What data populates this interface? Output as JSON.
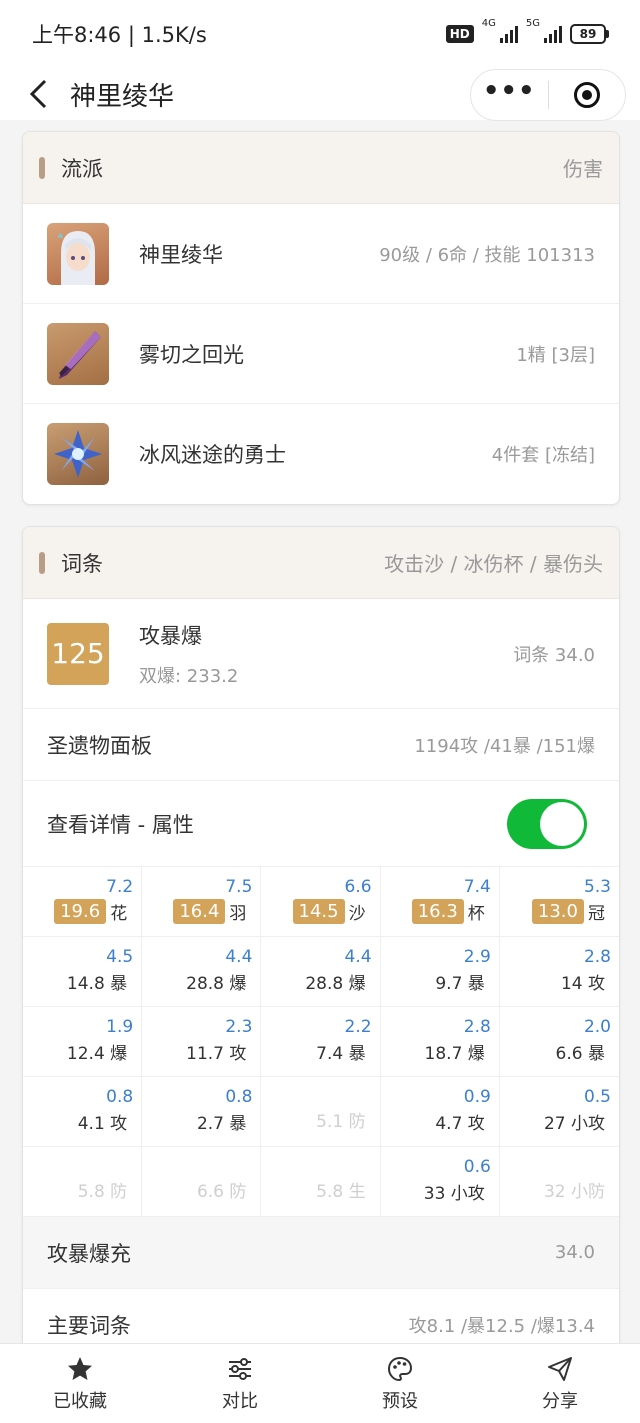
{
  "status_bar": {
    "time": "上午8:46 | 1.5K/s",
    "hd": "HD",
    "net1": "4G",
    "net2": "5G",
    "battery": "89"
  },
  "nav": {
    "title": "神里绫华"
  },
  "style_card": {
    "title": "流派",
    "right": "伤害",
    "items": [
      {
        "name": "神里绫华",
        "meta": "90级 / 6命 / 技能 101313"
      },
      {
        "name": "雾切之回光",
        "meta": "1精 [3层]"
      },
      {
        "name": "冰风迷途的勇士",
        "meta": "4件套 [冻结]"
      }
    ]
  },
  "stats_card": {
    "title": "词条",
    "right": "攻击沙 / 冰伤杯 / 暴伤头",
    "score": "125",
    "score_title": "攻暴爆",
    "score_sub": "双爆: 233.2",
    "score_right": "词条 34.0",
    "panel_label": "圣遗物面板",
    "panel_value": "1194攻 /41暴 /151爆",
    "detail_label": "查看详情 - 属性",
    "grid": [
      [
        {
          "top": "7.2",
          "pill": "19.6",
          "main": "花"
        },
        {
          "top": "7.5",
          "pill": "16.4",
          "main": "羽"
        },
        {
          "top": "6.6",
          "pill": "14.5",
          "main": "沙"
        },
        {
          "top": "7.4",
          "pill": "16.3",
          "main": "杯"
        },
        {
          "top": "5.3",
          "pill": "13.0",
          "main": "冠"
        }
      ],
      [
        {
          "top": "4.5",
          "main": "14.8 暴"
        },
        {
          "top": "4.4",
          "main": "28.8 爆"
        },
        {
          "top": "4.4",
          "main": "28.8 爆"
        },
        {
          "top": "2.9",
          "main": "9.7 暴"
        },
        {
          "top": "2.8",
          "main": "14 攻"
        }
      ],
      [
        {
          "top": "1.9",
          "main": "12.4 爆"
        },
        {
          "top": "2.3",
          "main": "11.7 攻"
        },
        {
          "top": "2.2",
          "main": "7.4 暴"
        },
        {
          "top": "2.8",
          "main": "18.7 爆"
        },
        {
          "top": "2.0",
          "main": "6.6 暴"
        }
      ],
      [
        {
          "top": "0.8",
          "main": "4.1 攻"
        },
        {
          "top": "0.8",
          "main": "2.7 暴"
        },
        {
          "top": "",
          "main": "5.1 防",
          "dim": true
        },
        {
          "top": "0.9",
          "main": "4.7 攻"
        },
        {
          "top": "0.5",
          "main": "27 小攻"
        }
      ],
      [
        {
          "top": "",
          "main": "5.8 防",
          "dim": true
        },
        {
          "top": "",
          "main": "6.6 防",
          "dim": true
        },
        {
          "top": "",
          "main": "5.8 生",
          "dim": true
        },
        {
          "top": "0.6",
          "main": "33 小攻"
        },
        {
          "top": "",
          "main": "32 小防",
          "dim": true
        }
      ]
    ],
    "summary_label": "攻暴爆充",
    "summary_value": "34.0",
    "main_label": "主要词条",
    "main_value": "攻8.1 /暴12.5 /爆13.4"
  },
  "tabs": [
    {
      "label": "已收藏",
      "icon": "star-icon"
    },
    {
      "label": "对比",
      "icon": "sliders-icon"
    },
    {
      "label": "预设",
      "icon": "palette-icon"
    },
    {
      "label": "分享",
      "icon": "send-icon"
    }
  ],
  "colors": {
    "accent": "#d4a35a",
    "blue": "#3b7fd0",
    "toggle": "#11b938"
  }
}
